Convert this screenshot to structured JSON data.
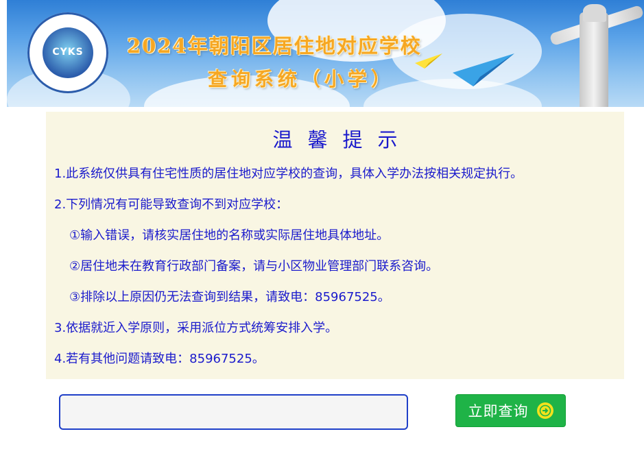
{
  "banner": {
    "title_line1": "2024年朝阳区居住地对应学校",
    "title_line2": "查询系统（小学）",
    "logo_text": "CYKS"
  },
  "notice": {
    "title": "温馨提示",
    "items": [
      "1.此系统仅供具有住宅性质的居住地对应学校的查询，具体入学办法按相关规定执行。",
      "2.下列情况有可能导致查询不到对应学校：",
      "①输入错误，请核实居住地的名称或实际居住地具体地址。",
      "②居住地未在教育行政部门备案，请与小区物业管理部门联系咨询。",
      "③排除以上原因仍无法查询到结果，请致电：85967525。",
      "3.依据就近入学原则，采用派位方式统筹安排入学。",
      "4.若有其他问题请致电：85967525。"
    ]
  },
  "search": {
    "value": "",
    "button_label": "立即查询",
    "button_icon": "arrow-right-circle-icon"
  },
  "colors": {
    "text_blue": "#1a1acc",
    "notice_bg": "#f9f6e3",
    "button_green": "#1fb347",
    "input_border": "#1f3fc8",
    "title_orange": "#f6a723"
  }
}
